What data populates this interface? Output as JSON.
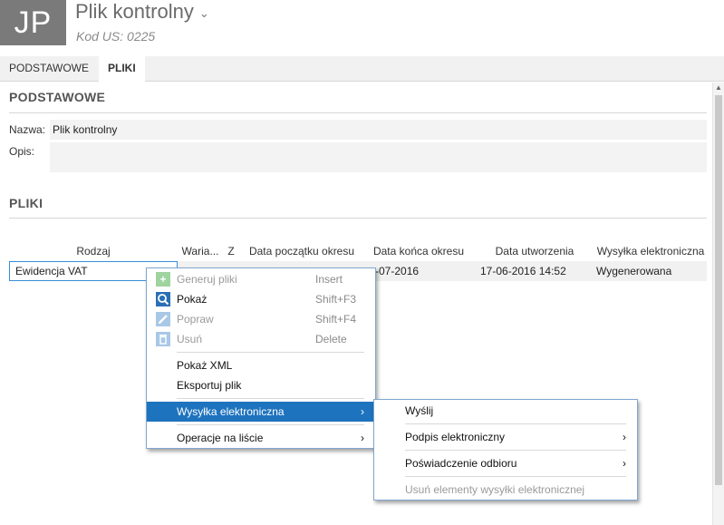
{
  "header": {
    "avatar_initials": "JP",
    "title": "Plik kontrolny",
    "subtitle": "Kod US: 0225"
  },
  "tabs": [
    {
      "label": "PODSTAWOWE",
      "active": false
    },
    {
      "label": "PLIKI",
      "active": true
    }
  ],
  "section_podstawowe": {
    "heading": "PODSTAWOWE",
    "name_label": "Nazwa:",
    "name_value": "Plik kontrolny",
    "desc_label": "Opis:",
    "desc_value": ""
  },
  "section_pliki": {
    "heading": "PLIKI",
    "columns": [
      "Rodzaj",
      "Waria...",
      "Z",
      "Data początku okresu",
      "Data końca okresu",
      "Data utworzenia",
      "Wysyłka elektroniczna"
    ],
    "rows": [
      {
        "rodzaj": "Ewidencja VAT",
        "data_konca": "-07-2016",
        "data_utworzenia": "17-06-2016 14:52",
        "wysylka": "Wygenerowana"
      }
    ]
  },
  "context_menu": {
    "items": [
      {
        "label": "Generuj pliki",
        "shortcut": "Insert",
        "icon": "plus-icon",
        "disabled": true
      },
      {
        "label": "Pokaż",
        "shortcut": "Shift+F3",
        "icon": "search-icon",
        "disabled": false
      },
      {
        "label": "Popraw",
        "shortcut": "Shift+F4",
        "icon": "edit-icon",
        "disabled": true
      },
      {
        "label": "Usuń",
        "shortcut": "Delete",
        "icon": "trash-icon",
        "disabled": true
      },
      {
        "label": "Pokaż XML"
      },
      {
        "label": "Eksportuj plik"
      },
      {
        "label": "Wysyłka elektroniczna",
        "submenu": true,
        "highlighted": true
      },
      {
        "label": "Operacje na liście",
        "submenu": true
      }
    ]
  },
  "submenu": {
    "items": [
      {
        "label": "Wyślij"
      },
      {
        "label": "Podpis elektroniczny",
        "submenu": true
      },
      {
        "label": "Poświadczenie odbioru",
        "submenu": true
      },
      {
        "label": "Usuń elementy wysyłki elektronicznej",
        "disabled": true
      }
    ]
  },
  "colors": {
    "accent": "#1e73be",
    "icon_green": "#5fb35f",
    "icon_blue": "#2a6fb5",
    "icon_disabled": "#a9c8e6"
  }
}
